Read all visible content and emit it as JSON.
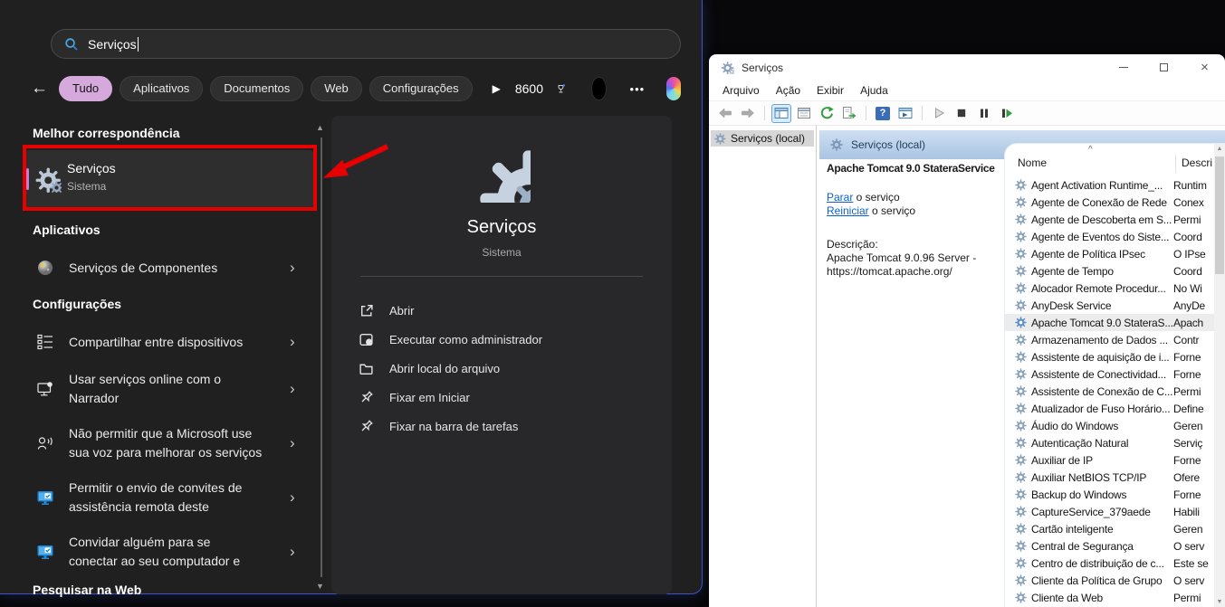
{
  "colors": {
    "annotation_red": "#e70000",
    "tab_selected": "#d6a9dc",
    "selection_accent": "#c77dd4",
    "link_blue": "#0a63c9",
    "mmc_header_blue": "#a9c4e2"
  },
  "glyphs": {
    "back_arrow": "←",
    "play": "▶",
    "ellipsis": "•••",
    "chevron": "›",
    "sort_caret": "^",
    "scroll_up": "▲",
    "scroll_down": "▼",
    "close": "×",
    "question": "?"
  },
  "search_panel": {
    "search": {
      "value": "Serviços"
    },
    "tabs": [
      {
        "label": "Tudo"
      },
      {
        "label": "Aplicativos"
      },
      {
        "label": "Documentos"
      },
      {
        "label": "Web"
      },
      {
        "label": "Configurações"
      }
    ],
    "rewards": {
      "points": "8600"
    },
    "sections": {
      "best_match": {
        "header": "Melhor correspondência",
        "item": {
          "title": "Serviços",
          "subtitle": "Sistema"
        }
      },
      "apps": {
        "header": "Aplicativos",
        "item": {
          "label": "Serviços de Componentes"
        }
      },
      "settings": {
        "header": "Configurações",
        "items": [
          {
            "line1": "Compartilhar entre dispositivos",
            "line2": "",
            "icon": "share-across-devices-icon"
          },
          {
            "line1": "Usar serviços online com o",
            "line2": "Narrador",
            "icon": "narrator-icon"
          },
          {
            "line1": "Não permitir que a Microsoft use",
            "line2": "sua voz para melhorar os serviços",
            "icon": "voice-icon"
          },
          {
            "line1": "Permitir o envio de convites de",
            "line2": "assistência remota deste",
            "icon": "remote-assistance-icon"
          },
          {
            "line1": "Convidar alguém para se",
            "line2": "conectar ao seu computador e",
            "icon": "remote-assistance-icon"
          }
        ]
      },
      "web": {
        "header": "Pesquisar na Web"
      }
    },
    "preview": {
      "title": "Serviços",
      "subtitle": "Sistema",
      "actions": [
        {
          "label": "Abrir",
          "icon": "open-icon"
        },
        {
          "label": "Executar como administrador",
          "icon": "run-as-admin-icon"
        },
        {
          "label": "Abrir local do arquivo",
          "icon": "open-file-location-icon"
        },
        {
          "label": "Fixar em Iniciar",
          "icon": "pin-icon"
        },
        {
          "label": "Fixar na barra de tarefas",
          "icon": "pin-icon"
        }
      ]
    }
  },
  "services_window": {
    "title": "Serviços",
    "menus": [
      "Arquivo",
      "Ação",
      "Exibir",
      "Ajuda"
    ],
    "toolbar_icons": [
      "back-icon",
      "forward-icon",
      "show-console-tree-icon",
      "properties-icon",
      "refresh-icon",
      "export-list-icon",
      "help-icon",
      "show-action-pane-icon",
      "start-service-icon",
      "stop-service-icon",
      "pause-service-icon",
      "restart-service-icon"
    ],
    "tree": {
      "root": "Serviços (local)"
    },
    "detail": {
      "header": "Serviços (local)",
      "service_name": "Apache Tomcat 9.0 StateraService",
      "stop_link": "Parar",
      "stop_suffix": " o serviço",
      "restart_link": "Reiniciar",
      "restart_suffix": " o serviço",
      "description_label": "Descrição:",
      "description_line1": "Apache Tomcat 9.0.96 Server -",
      "description_line2": "https://tomcat.apache.org/"
    },
    "list": {
      "columns": [
        "Nome",
        "Descri"
      ],
      "selected_index": 8,
      "rows": [
        {
          "name": "Agent Activation Runtime_...",
          "desc": "Runtim"
        },
        {
          "name": "Agente de Conexão de Rede",
          "desc": "Conex"
        },
        {
          "name": "Agente de Descoberta em S...",
          "desc": "Permi"
        },
        {
          "name": "Agente de Eventos do Siste...",
          "desc": "Coord"
        },
        {
          "name": "Agente de Política IPsec",
          "desc": "O IPse"
        },
        {
          "name": "Agente de Tempo",
          "desc": "Coord"
        },
        {
          "name": "Alocador Remote Procedur...",
          "desc": "No Wi"
        },
        {
          "name": "AnyDesk Service",
          "desc": "AnyDe"
        },
        {
          "name": "Apache Tomcat 9.0 StateraS...",
          "desc": "Apach"
        },
        {
          "name": "Armazenamento de Dados ...",
          "desc": "Contr"
        },
        {
          "name": "Assistente de aquisição de i...",
          "desc": "Forne"
        },
        {
          "name": "Assistente de Conectividad...",
          "desc": "Forne"
        },
        {
          "name": "Assistente de Conexão de C...",
          "desc": "Permi"
        },
        {
          "name": "Atualizador de Fuso Horário...",
          "desc": "Define"
        },
        {
          "name": "Áudio do Windows",
          "desc": "Geren"
        },
        {
          "name": "Autenticação Natural",
          "desc": "Serviç"
        },
        {
          "name": "Auxiliar de IP",
          "desc": "Forne"
        },
        {
          "name": "Auxiliar NetBIOS TCP/IP",
          "desc": "Ofere"
        },
        {
          "name": "Backup do Windows",
          "desc": "Forne"
        },
        {
          "name": "CaptureService_379aede",
          "desc": "Habili"
        },
        {
          "name": "Cartão inteligente",
          "desc": "Geren"
        },
        {
          "name": "Central de Segurança",
          "desc": "O serv"
        },
        {
          "name": "Centro de distribuição de c...",
          "desc": "Este se"
        },
        {
          "name": "Cliente da Política de Grupo",
          "desc": "O serv"
        },
        {
          "name": "Cliente da Web",
          "desc": "Permi"
        }
      ]
    }
  }
}
